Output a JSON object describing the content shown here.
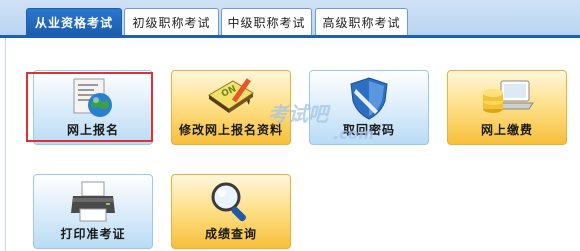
{
  "tabs": [
    {
      "label": "从业资格考试",
      "active": true
    },
    {
      "label": "初级职称考试",
      "active": false
    },
    {
      "label": "中级职称考试",
      "active": false
    },
    {
      "label": "高级职称考试",
      "active": false
    }
  ],
  "tiles": [
    {
      "label": "网上报名",
      "icon": "globe-document-icon",
      "style": "blue",
      "selected": true
    },
    {
      "label": "修改网上报名资料",
      "icon": "notepad-pencil-icon",
      "style": "orange",
      "selected": false
    },
    {
      "label": "取回密码",
      "icon": "shield-icon",
      "style": "blue",
      "selected": false
    },
    {
      "label": "网上缴费",
      "icon": "coins-laptop-icon",
      "style": "orange",
      "selected": false
    },
    {
      "label": "打印准考证",
      "icon": "printer-icon",
      "style": "blue",
      "selected": false
    },
    {
      "label": "成绩查询",
      "icon": "magnifier-icon",
      "style": "orange",
      "selected": false
    }
  ],
  "watermark": {
    "text": "考试吧",
    "sub": ".com"
  },
  "colors": {
    "accent": "#1d5fb4",
    "highlight": "#e03030"
  }
}
